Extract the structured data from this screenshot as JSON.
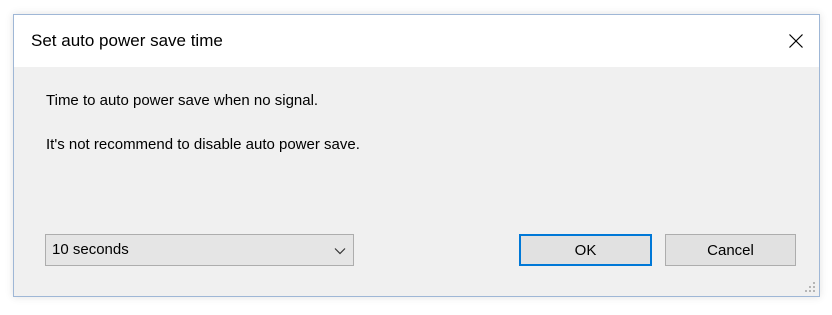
{
  "window": {
    "title": "Set auto power save time",
    "close_icon": "close-icon"
  },
  "message": {
    "line1": "Time to auto power save when no signal.",
    "line2": "It's not recommend to disable auto power save."
  },
  "timeout_select": {
    "selected": "10 seconds",
    "arrow_icon": "chevron-down-icon"
  },
  "buttons": {
    "ok_label": "OK",
    "cancel_label": "Cancel"
  },
  "colors": {
    "dialog_background": "#f0f0f0",
    "titlebar_background": "#ffffff",
    "default_button_border": "#0078d7"
  }
}
